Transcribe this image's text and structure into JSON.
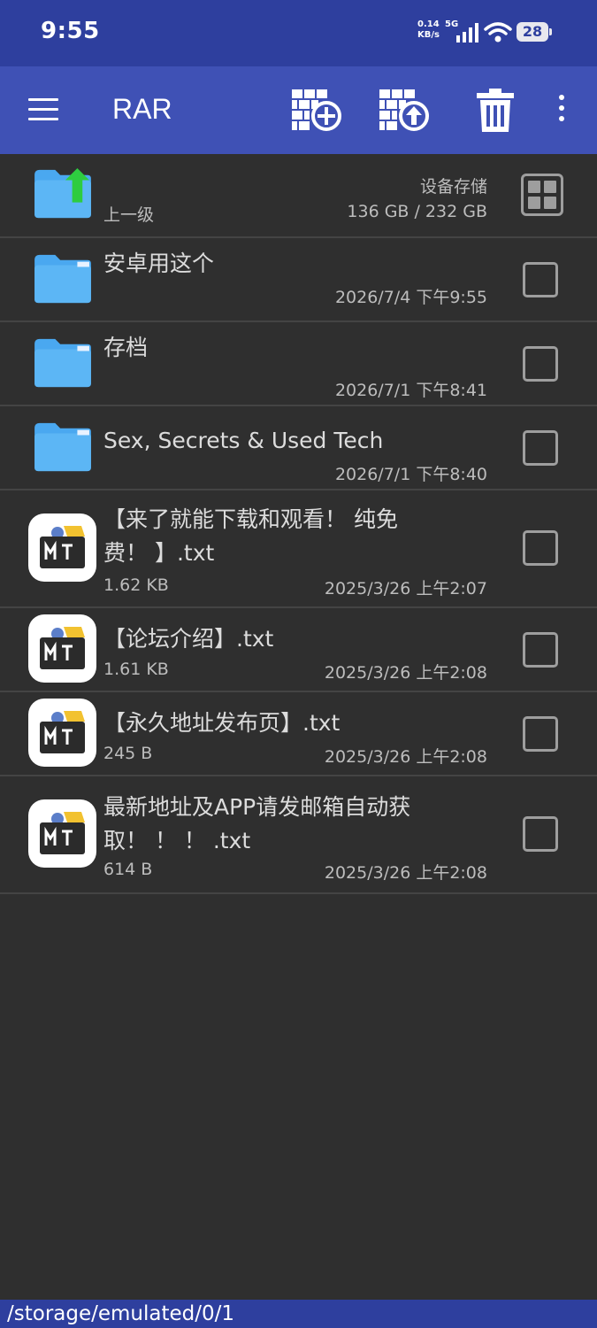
{
  "status_bar": {
    "time": "9:55",
    "net_speed_value": "0.14",
    "net_speed_unit": "KB/s",
    "network_type": "5G",
    "battery": "28"
  },
  "toolbar": {
    "title": "RAR",
    "icons": [
      "menu-icon",
      "add-archive-icon",
      "extract-archive-icon",
      "trash-icon",
      "more-vert-icon"
    ]
  },
  "parent_row": {
    "label": "上一级",
    "storage_label": "设备存储",
    "storage_usage": "136 GB / 232 GB"
  },
  "items": [
    {
      "name": "安卓用这个",
      "date": "2026/7/4 下午9:55"
    },
    {
      "name": "存档",
      "date": "2026/7/1 下午8:41"
    },
    {
      "name": "Sex, Secrets & Used Tech",
      "date": "2026/7/1 下午8:40"
    },
    {
      "name_line1": "【来了就能下载和观看！ 纯免",
      "name_line2": "费！ 】.txt",
      "size": "1.62 KB",
      "date": "2025/3/26 上午2:07"
    },
    {
      "name": "【论坛介绍】.txt",
      "size": "1.61 KB",
      "date": "2025/3/26 上午2:08"
    },
    {
      "name": "【永久地址发布页】.txt",
      "size": "245 B",
      "date": "2025/3/26 上午2:08"
    },
    {
      "name_line1": "最新地址及APP请发邮箱自动获",
      "name_line2": "取！ ！ ！ .txt",
      "size": "614 B",
      "date": "2025/3/26 上午2:08"
    }
  ],
  "path": "/storage/emulated/0/1",
  "colors": {
    "statusbar": "#2e3f9e",
    "toolbar": "#3f51b5",
    "background": "#2f2f2f",
    "folder": "#4aa8f0",
    "up_arrow": "#2ecc40"
  }
}
